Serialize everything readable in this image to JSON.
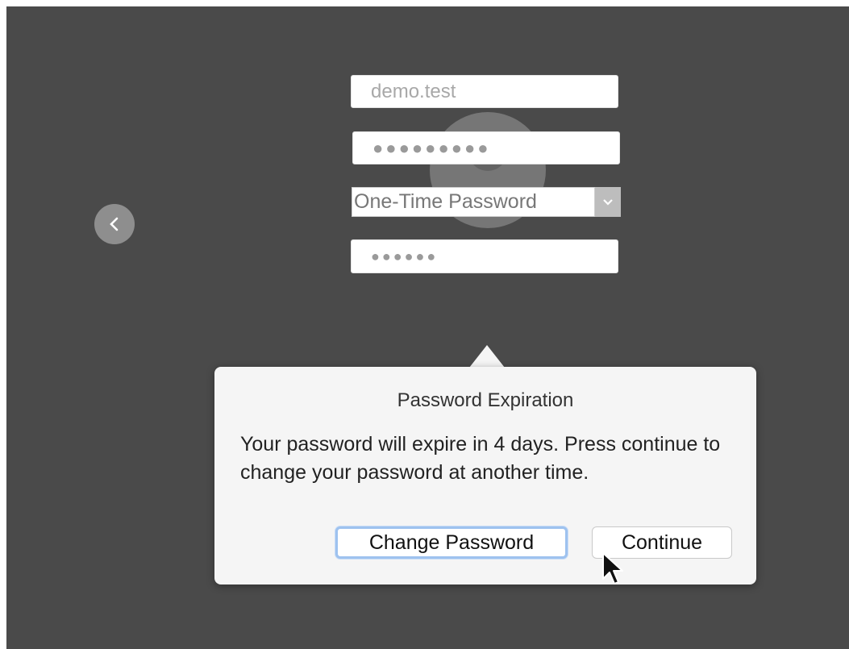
{
  "login": {
    "username_value": "",
    "username_placeholder": "demo.test",
    "password_masked": "●●●●●●●●●",
    "auth_method": {
      "selected": "One-Time Password"
    },
    "otp_masked": "●●●●●●"
  },
  "popover": {
    "title": "Password Expiration",
    "message": "Your password will expire in 4 days. Press continue to change your password at another time.",
    "buttons": {
      "change_password": "Change Password",
      "continue": "Continue"
    }
  },
  "icons": {
    "back": "chevron-left-icon",
    "select_arrow": "chevron-down-icon",
    "avatar": "user-avatar-icon",
    "cursor": "mouse-pointer-icon"
  },
  "colors": {
    "background": "#4a4a4a",
    "popover": "#f5f5f5",
    "focus_ring": "#9ec2ef"
  }
}
